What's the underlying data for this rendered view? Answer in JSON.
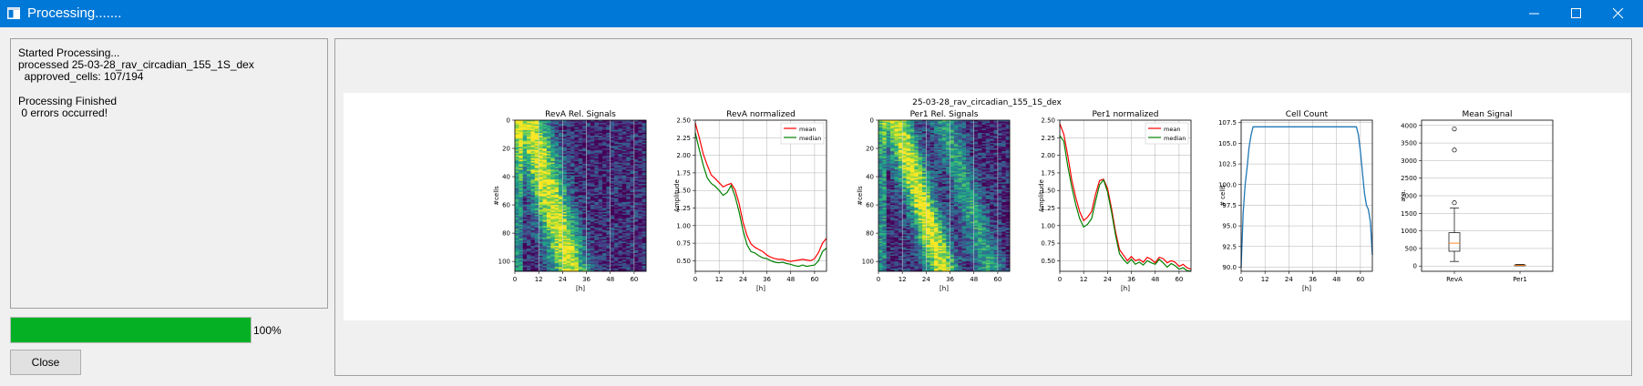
{
  "window": {
    "title": "Processing.......",
    "icon": "window-app-icon",
    "controls": [
      "minimize-icon",
      "maximize-icon",
      "close-icon"
    ]
  },
  "log": {
    "lines": [
      "Started Processing...",
      "processed 25-03-28_rav_circadian_155_1S_dex",
      "  approved_cells: 107/194",
      "",
      "Processing Finished",
      " 0 errors occurred!"
    ]
  },
  "progress": {
    "value": 100,
    "label": "100%",
    "color": "#06b025"
  },
  "buttons": {
    "close": "Close"
  },
  "figure": {
    "suptitle": "25-03-28_rav_circadian_155_1S_dex",
    "colors": {
      "mean": "#ff0000",
      "median": "#008000",
      "count": "#1f77b4",
      "box": "#000000",
      "median_line": "#ff7f0e"
    },
    "panels": [
      {
        "title": "RevA Rel. Signals",
        "xlabel": "[h]",
        "ylabel": "#cells"
      },
      {
        "title": "RevA normalized",
        "xlabel": "[h]",
        "ylabel": "Amplitude"
      },
      {
        "title": "Per1 Rel. Signals",
        "xlabel": "[h]",
        "ylabel": "#cells"
      },
      {
        "title": "Per1 normalized",
        "xlabel": "[h]",
        "ylabel": "Amplitude"
      },
      {
        "title": "Cell Count",
        "xlabel": "[h]",
        "ylabel": "# cells"
      },
      {
        "title": "Mean Signal",
        "xlabel": "",
        "ylabel": "a.u."
      }
    ],
    "legend": [
      "mean",
      "median"
    ]
  },
  "chart_data": [
    {
      "type": "heatmap",
      "title": "RevA Rel. Signals",
      "xlabel": "[h]",
      "ylabel": "#cells",
      "xticks": [
        "0",
        "12",
        "24",
        "36",
        "48",
        "60"
      ],
      "yticks": [
        "0",
        "20",
        "40",
        "60",
        "80",
        "100"
      ],
      "xlim": [
        0,
        66
      ],
      "ylim": [
        107,
        0
      ],
      "colormap": "viridis",
      "grid": true
    },
    {
      "type": "line",
      "title": "RevA normalized",
      "xlabel": "[h]",
      "ylabel": "Amplitude",
      "xticks": [
        "0",
        "12",
        "24",
        "36",
        "48",
        "60"
      ],
      "yticks": [
        "0.50",
        "0.75",
        "1.00",
        "1.25",
        "1.50",
        "1.75",
        "2.00",
        "2.25",
        "2.50"
      ],
      "xlim": [
        0,
        66
      ],
      "ylim": [
        0.35,
        2.5
      ],
      "legend": "top-right",
      "grid": true,
      "x": [
        0,
        2,
        4,
        6,
        8,
        10,
        12,
        14,
        16,
        18,
        20,
        22,
        24,
        26,
        28,
        30,
        32,
        34,
        36,
        38,
        40,
        42,
        44,
        46,
        48,
        50,
        52,
        54,
        56,
        58,
        60,
        62,
        64,
        66
      ],
      "series": [
        {
          "name": "mean",
          "values": [
            2.46,
            2.25,
            2.02,
            1.86,
            1.72,
            1.67,
            1.61,
            1.55,
            1.58,
            1.6,
            1.51,
            1.32,
            1.05,
            0.86,
            0.74,
            0.69,
            0.66,
            0.63,
            0.58,
            0.55,
            0.53,
            0.52,
            0.52,
            0.5,
            0.49,
            0.5,
            0.51,
            0.52,
            0.51,
            0.5,
            0.53,
            0.62,
            0.75,
            0.82
          ]
        },
        {
          "name": "median",
          "values": [
            2.32,
            2.08,
            1.86,
            1.68,
            1.6,
            1.56,
            1.5,
            1.43,
            1.47,
            1.57,
            1.42,
            1.2,
            0.93,
            0.73,
            0.63,
            0.61,
            0.57,
            0.54,
            0.53,
            0.5,
            0.48,
            0.47,
            0.48,
            0.46,
            0.45,
            0.43,
            0.42,
            0.44,
            0.42,
            0.43,
            0.44,
            0.5,
            0.63,
            0.68
          ]
        }
      ]
    },
    {
      "type": "heatmap",
      "title": "Per1 Rel. Signals",
      "xlabel": "[h]",
      "ylabel": "#cells",
      "xticks": [
        "0",
        "12",
        "24",
        "36",
        "48",
        "60"
      ],
      "yticks": [
        "0",
        "20",
        "40",
        "60",
        "80",
        "100"
      ],
      "xlim": [
        0,
        66
      ],
      "ylim": [
        107,
        0
      ],
      "colormap": "viridis",
      "grid": true
    },
    {
      "type": "line",
      "title": "Per1 normalized",
      "xlabel": "[h]",
      "ylabel": "Amplitude",
      "xticks": [
        "0",
        "12",
        "24",
        "36",
        "48",
        "60"
      ],
      "yticks": [
        "0.50",
        "0.75",
        "1.00",
        "1.25",
        "1.50",
        "1.75",
        "2.00",
        "2.25",
        "2.50"
      ],
      "xlim": [
        0,
        66
      ],
      "ylim": [
        0.35,
        2.5
      ],
      "legend": "top-right",
      "grid": true,
      "x": [
        0,
        2,
        4,
        6,
        8,
        10,
        12,
        14,
        16,
        18,
        20,
        22,
        24,
        26,
        28,
        30,
        32,
        34,
        36,
        38,
        40,
        42,
        44,
        46,
        48,
        50,
        52,
        54,
        56,
        58,
        60,
        62,
        64,
        66
      ],
      "series": [
        {
          "name": "mean",
          "values": [
            2.45,
            2.3,
            2.0,
            1.65,
            1.4,
            1.2,
            1.07,
            1.12,
            1.2,
            1.45,
            1.64,
            1.66,
            1.53,
            1.25,
            0.92,
            0.66,
            0.58,
            0.5,
            0.56,
            0.5,
            0.52,
            0.48,
            0.55,
            0.52,
            0.47,
            0.55,
            0.53,
            0.47,
            0.5,
            0.48,
            0.42,
            0.45,
            0.4,
            0.38
          ]
        },
        {
          "name": "median",
          "values": [
            2.28,
            2.2,
            1.85,
            1.55,
            1.3,
            1.1,
            0.98,
            1.02,
            1.1,
            1.35,
            1.58,
            1.65,
            1.48,
            1.2,
            0.87,
            0.6,
            0.52,
            0.46,
            0.52,
            0.45,
            0.48,
            0.44,
            0.5,
            0.47,
            0.45,
            0.52,
            0.47,
            0.41,
            0.46,
            0.43,
            0.38,
            0.4,
            0.36,
            0.35
          ]
        }
      ]
    },
    {
      "type": "line",
      "title": "Cell Count",
      "xlabel": "[h]",
      "ylabel": "# cells",
      "xticks": [
        "0",
        "12",
        "24",
        "36",
        "48",
        "60"
      ],
      "yticks": [
        "90.0",
        "92.5",
        "95.0",
        "97.5",
        "100.0",
        "102.5",
        "105.0",
        "107.5"
      ],
      "xlim": [
        0,
        66
      ],
      "ylim": [
        89.5,
        107.8
      ],
      "grid": true,
      "x": [
        0,
        1,
        2,
        3,
        4,
        5,
        6,
        7,
        58,
        59,
        60,
        61,
        62,
        63,
        64,
        65,
        66
      ],
      "series": [
        {
          "name": "",
          "values": [
            90.0,
            96.5,
            100.0,
            102.0,
            104.5,
            106.0,
            107.0,
            107.0,
            107.0,
            106.0,
            104.0,
            101.5,
            99.0,
            97.5,
            97.0,
            95.5,
            91.5
          ]
        }
      ]
    },
    {
      "type": "box",
      "title": "Mean Signal",
      "ylabel": "a.u.",
      "categories": [
        "RevA",
        "Per1"
      ],
      "yticks": [
        "0",
        "500",
        "1000",
        "1500",
        "2000",
        "2500",
        "3000",
        "3500",
        "4000"
      ],
      "ylim": [
        -150,
        4150
      ],
      "grid": true,
      "boxes": [
        {
          "name": "RevA",
          "whisker_low": 130,
          "q1": 420,
          "median": 650,
          "q3": 950,
          "whisker_high": 1650,
          "outliers": [
            1800,
            3300,
            3900
          ]
        },
        {
          "name": "Per1",
          "whisker_low": 8,
          "q1": 12,
          "median": 20,
          "q3": 30,
          "whisker_high": 45,
          "outliers": []
        }
      ]
    }
  ]
}
